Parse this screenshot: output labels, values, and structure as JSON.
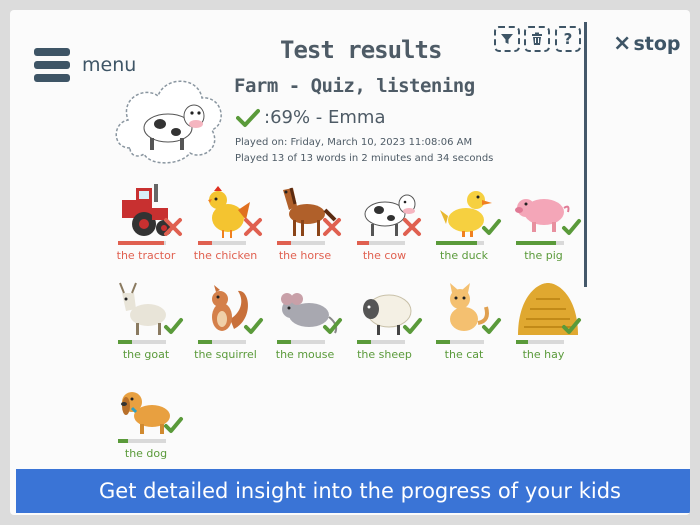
{
  "header": {
    "menu_label": "menu",
    "title": "Test results",
    "stop_label": "stop",
    "tools": [
      {
        "name": "filter-icon",
        "glyph": "⏷"
      },
      {
        "name": "trash-icon",
        "glyph": "🗑"
      },
      {
        "name": "help-icon",
        "glyph": "?"
      }
    ]
  },
  "summary": {
    "quiz_title": "Farm - Quiz, listening",
    "score_line": ":69% - Emma",
    "played_on": "Played on: Friday, March 10, 2023 11:08:06 AM",
    "played_count": "Played 13 of 13 words in 2 minutes and 34 seconds",
    "cover_icon": "cow-icon"
  },
  "colors": {
    "correct": "#5a9a3a",
    "wrong": "#e06050",
    "bar_bg": "#d9d9d9",
    "ui": "#3e5566",
    "banner": "#3a74d6"
  },
  "results": [
    {
      "word": "the tractor",
      "icon": "tractor-icon",
      "correct": false,
      "score": 0.95
    },
    {
      "word": "the chicken",
      "icon": "chicken-icon",
      "correct": false,
      "score": 0.3
    },
    {
      "word": "the horse",
      "icon": "horse-icon",
      "correct": false,
      "score": 0.3
    },
    {
      "word": "the cow",
      "icon": "cow-icon",
      "correct": false,
      "score": 0.25
    },
    {
      "word": "the duck",
      "icon": "duck-icon",
      "correct": true,
      "score": 0.85
    },
    {
      "word": "the pig",
      "icon": "pig-icon",
      "correct": true,
      "score": 0.85
    },
    {
      "word": "the goat",
      "icon": "goat-icon",
      "correct": true,
      "score": 0.3
    },
    {
      "word": "the squirrel",
      "icon": "squirrel-icon",
      "correct": true,
      "score": 0.3
    },
    {
      "word": "the mouse",
      "icon": "mouse-icon",
      "correct": true,
      "score": 0.3
    },
    {
      "word": "the sheep",
      "icon": "sheep-icon",
      "correct": true,
      "score": 0.3
    },
    {
      "word": "the cat",
      "icon": "cat-icon",
      "correct": true,
      "score": 0.3
    },
    {
      "word": "the hay",
      "icon": "hay-icon",
      "correct": true,
      "score": 0.25
    },
    {
      "word": "the dog",
      "icon": "dog-icon",
      "correct": true,
      "score": 0.2
    }
  ],
  "banner": "Get detailed insight into the progress of your kids"
}
